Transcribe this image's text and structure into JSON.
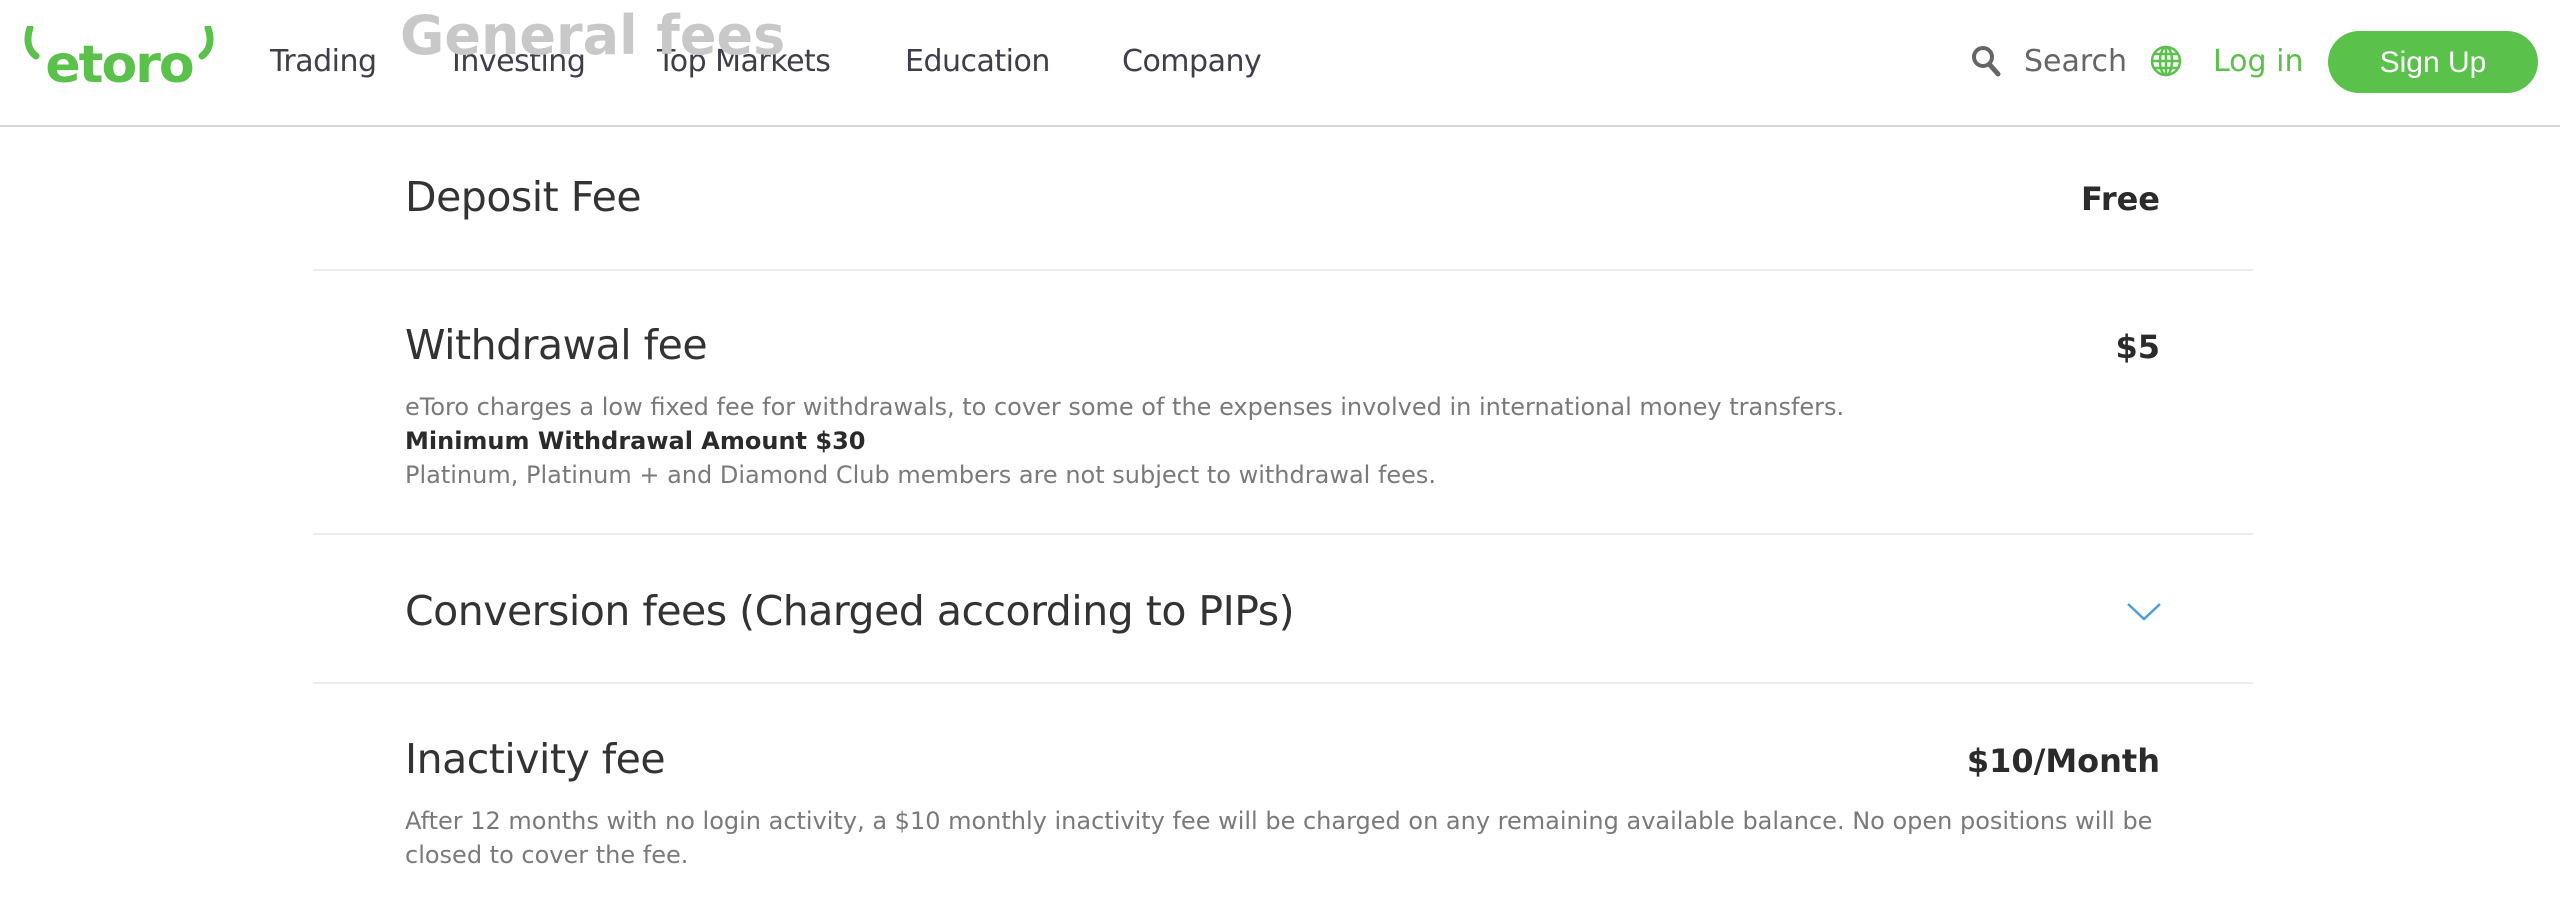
{
  "background_heading": "General fees",
  "header": {
    "logo_text": "etoro",
    "nav": [
      "Trading",
      "Investing",
      "Top Markets",
      "Education",
      "Company"
    ],
    "search_label": "Search",
    "login_label": "Log in",
    "signup_label": "Sign Up",
    "brand_color": "#5ac14b"
  },
  "fees": [
    {
      "title": "Deposit Fee",
      "value": "Free"
    },
    {
      "title": "Withdrawal fee",
      "value": "$5",
      "desc": [
        "eToro charges a low fixed fee for withdrawals, to cover some of the expenses involved in international money transfers.",
        "Minimum Withdrawal Amount $30",
        "Platinum, Platinum + and Diamond Club members are not subject to withdrawal fees."
      ]
    },
    {
      "title": "Conversion fees (Charged according to PIPs)",
      "icon": "chevron-down-icon"
    },
    {
      "title": "Inactivity fee",
      "value": "$10/Month",
      "desc": [
        "After 12 months with no login activity, a $10 monthly inactivity fee will be charged on any remaining available balance. No open positions will be closed to cover the fee."
      ]
    }
  ]
}
